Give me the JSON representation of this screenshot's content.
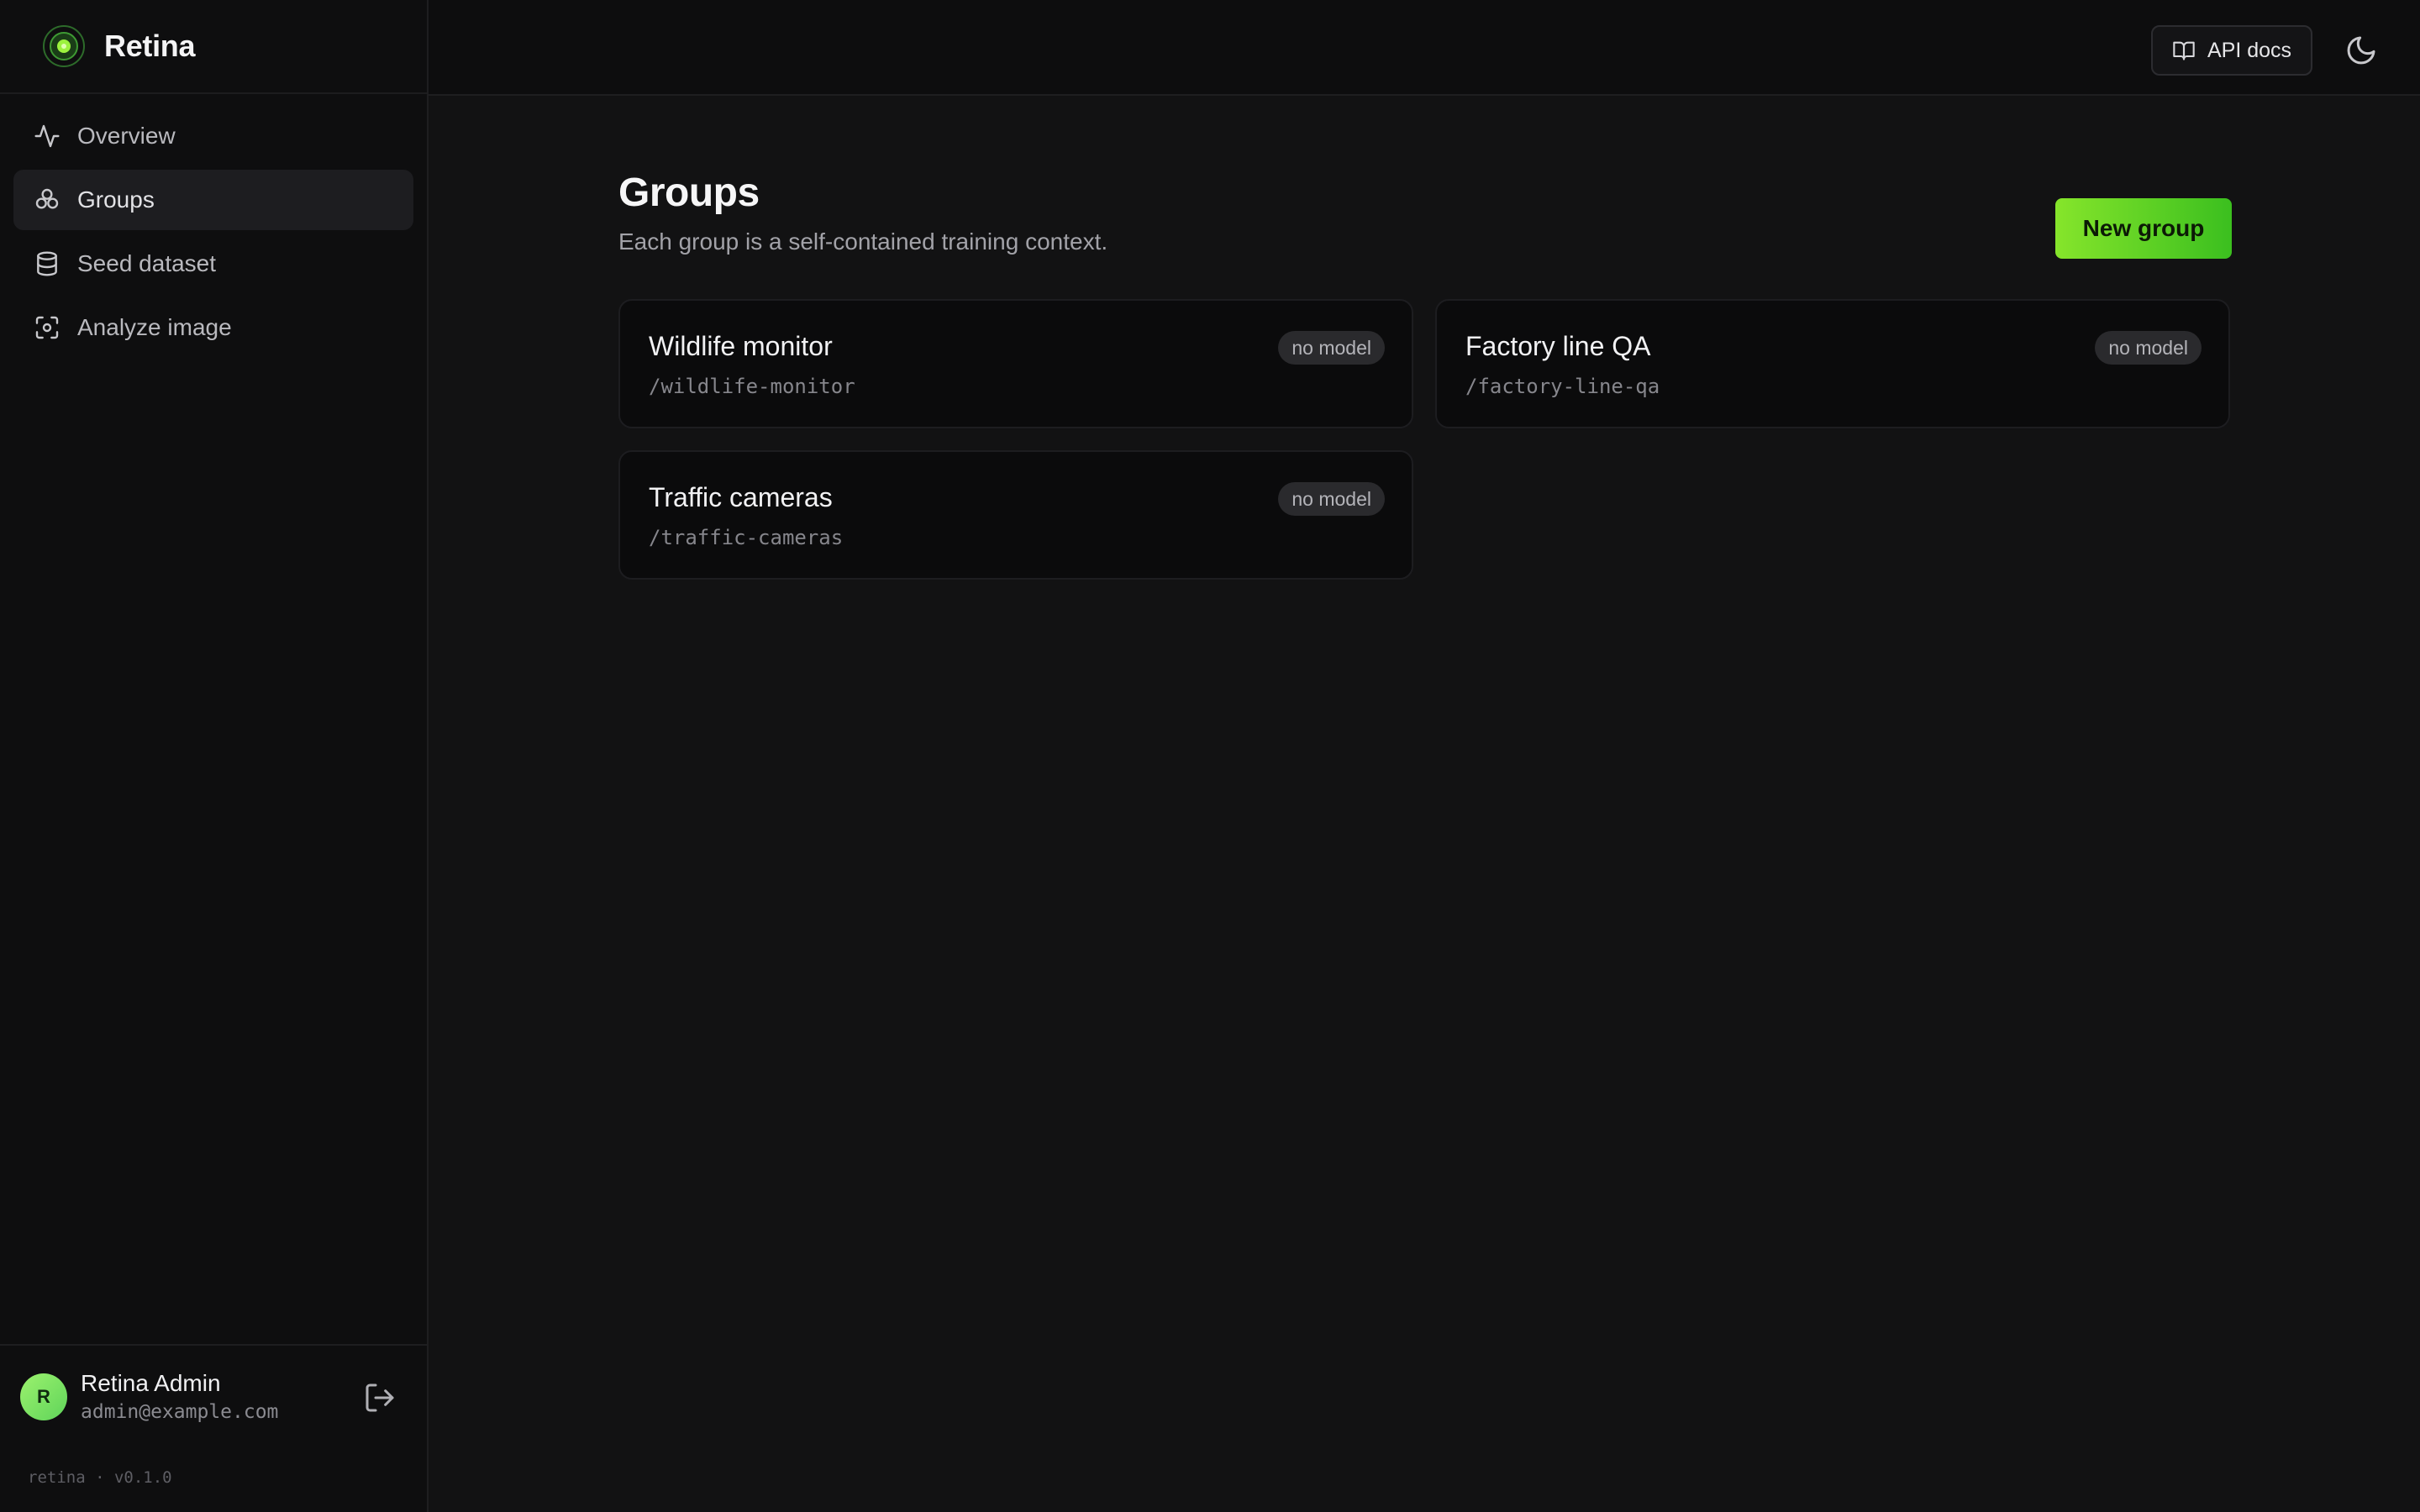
{
  "brand": {
    "name": "Retina"
  },
  "sidebar": {
    "items": [
      {
        "label": "Overview",
        "icon": "activity-icon",
        "active": false
      },
      {
        "label": "Groups",
        "icon": "groups-icon",
        "active": true
      },
      {
        "label": "Seed dataset",
        "icon": "database-icon",
        "active": false
      },
      {
        "label": "Analyze image",
        "icon": "scan-icon",
        "active": false
      }
    ]
  },
  "user": {
    "initial": "R",
    "name": "Retina Admin",
    "email": "admin@example.com"
  },
  "footer": {
    "version": "retina · v0.1.0"
  },
  "topbar": {
    "api_docs_label": "API docs"
  },
  "page": {
    "title": "Groups",
    "subtitle": "Each group is a self-contained training context.",
    "new_button_label": "New group"
  },
  "groups": [
    {
      "name": "Wildlife monitor",
      "slug": "/wildlife-monitor",
      "badge": "no model"
    },
    {
      "name": "Factory line QA",
      "slug": "/factory-line-qa",
      "badge": "no model"
    },
    {
      "name": "Traffic cameras",
      "slug": "/traffic-cameras",
      "badge": "no model"
    }
  ],
  "colors": {
    "accent": "#6fd62a",
    "background": "#121213",
    "sidebar": "#0e0e0f",
    "card": "#0b0b0c"
  }
}
